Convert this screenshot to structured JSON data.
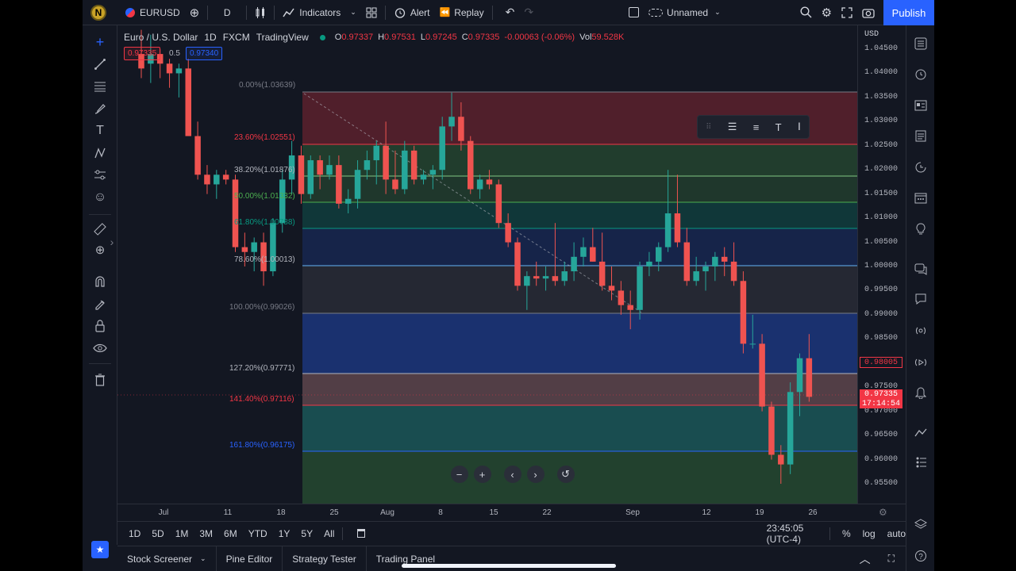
{
  "topbar": {
    "avatar_letter": "N",
    "symbol": "EURUSD",
    "add_symbol_icon": "plus-circle-icon",
    "interval": "D",
    "indicators_label": "Indicators",
    "alert_label": "Alert",
    "replay_label": "Replay",
    "layout_name": "Unnamed",
    "publish_label": "Publish"
  },
  "legend": {
    "title": "Euro / U.S. Dollar",
    "interval": "1D",
    "exchange": "FXCM",
    "source": "TradingView",
    "o_label": "O",
    "o_val": "0.97337",
    "h_label": "H",
    "h_val": "0.97531",
    "l_label": "L",
    "l_val": "0.97245",
    "c_label": "C",
    "c_val": "0.97335",
    "change": "-0.00063 (-0.06%)",
    "vol_label": "Vol",
    "vol_val": "59.528K"
  },
  "price_boxes": {
    "sell": "0.97335",
    "spread": "0.5",
    "buy": "0.97340"
  },
  "colors": {
    "up": "#26a69a",
    "down": "#ef5350",
    "background": "#131722",
    "accent": "#2962ff"
  },
  "fib_labels": [
    {
      "text": "0.00%(1.03639)",
      "color": "#787b86"
    },
    {
      "text": "23.60%(1.02551)",
      "color": "#f23645"
    },
    {
      "text": "38.20%(1.01876)",
      "color": "#b2b5be"
    },
    {
      "text": "50.00%(1.01332)",
      "color": "#4caf50"
    },
    {
      "text": "61.80%(1.00788)",
      "color": "#089981"
    },
    {
      "text": "78.60%(1.00013)",
      "color": "#b2b5be"
    },
    {
      "text": "100.00%(0.99026)",
      "color": "#787b86"
    },
    {
      "text": "127.20%(0.97771)",
      "color": "#b2b5be"
    },
    {
      "text": "141.40%(0.97116)",
      "color": "#f23645"
    },
    {
      "text": "161.80%(0.96175)",
      "color": "#2962ff"
    }
  ],
  "y_axis": {
    "currency": "USD",
    "ticks": [
      "1.04500",
      "1.04000",
      "1.03500",
      "1.03000",
      "1.02500",
      "1.02000",
      "1.01500",
      "1.01000",
      "1.00500",
      "1.00000",
      "0.99500",
      "0.99000",
      "0.98500",
      "0.98000",
      "0.97500",
      "0.97000",
      "0.96500",
      "0.96000",
      "0.95500"
    ],
    "tag_red": "0.98005",
    "tag_last": "0.97335",
    "tag_timer": "17:14:54"
  },
  "x_axis": {
    "ticks": [
      "Jul",
      "11",
      "18",
      "25",
      "Aug",
      "8",
      "15",
      "22",
      "Sep",
      "12",
      "19",
      "26"
    ]
  },
  "ranges": [
    "1D",
    "5D",
    "1M",
    "3M",
    "6M",
    "YTD",
    "1Y",
    "5Y",
    "All"
  ],
  "clock": "23:45:05 (UTC-4)",
  "scale_opts": {
    "percent": "%",
    "log": "log",
    "auto": "auto"
  },
  "bottom_tabs": [
    "Stock Screener",
    "Pine Editor",
    "Strategy Tester",
    "Trading Panel"
  ],
  "chart_data": {
    "type": "candlestick",
    "ylim": [
      0.95,
      1.05
    ],
    "candles": [
      {
        "o": 1.044,
        "h": 1.049,
        "l": 1.039,
        "c": 1.041
      },
      {
        "o": 1.042,
        "h": 1.048,
        "l": 1.038,
        "c": 1.044
      },
      {
        "o": 1.044,
        "h": 1.045,
        "l": 1.039,
        "c": 1.042
      },
      {
        "o": 1.042,
        "h": 1.043,
        "l": 1.037,
        "c": 1.04
      },
      {
        "o": 1.04,
        "h": 1.042,
        "l": 1.035,
        "c": 1.041
      },
      {
        "o": 1.041,
        "h": 1.043,
        "l": 1.028,
        "c": 1.027
      },
      {
        "o": 1.027,
        "h": 1.03,
        "l": 1.018,
        "c": 1.019
      },
      {
        "o": 1.019,
        "h": 1.021,
        "l": 1.015,
        "c": 1.017
      },
      {
        "o": 1.017,
        "h": 1.02,
        "l": 1.014,
        "c": 1.019
      },
      {
        "o": 1.019,
        "h": 1.02,
        "l": 1.017,
        "c": 1.018
      },
      {
        "o": 1.018,
        "h": 1.019,
        "l": 1.003,
        "c": 1.004
      },
      {
        "o": 1.004,
        "h": 1.007,
        "l": 1.0,
        "c": 1.003
      },
      {
        "o": 1.003,
        "h": 1.006,
        "l": 0.999,
        "c": 1.005
      },
      {
        "o": 1.005,
        "h": 1.007,
        "l": 0.996,
        "c": 0.999
      },
      {
        "o": 0.999,
        "h": 1.01,
        "l": 0.998,
        "c": 1.009
      },
      {
        "o": 1.009,
        "h": 1.02,
        "l": 1.007,
        "c": 1.018
      },
      {
        "o": 1.018,
        "h": 1.026,
        "l": 1.015,
        "c": 1.023
      },
      {
        "o": 1.023,
        "h": 1.025,
        "l": 1.013,
        "c": 1.015
      },
      {
        "o": 1.015,
        "h": 1.023,
        "l": 1.014,
        "c": 1.022
      },
      {
        "o": 1.022,
        "h": 1.023,
        "l": 1.016,
        "c": 1.019
      },
      {
        "o": 1.019,
        "h": 1.023,
        "l": 1.018,
        "c": 1.021
      },
      {
        "o": 1.021,
        "h": 1.023,
        "l": 1.012,
        "c": 1.013
      },
      {
        "o": 1.013,
        "h": 1.016,
        "l": 1.011,
        "c": 1.014
      },
      {
        "o": 1.014,
        "h": 1.022,
        "l": 1.012,
        "c": 1.02
      },
      {
        "o": 1.02,
        "h": 1.024,
        "l": 1.018,
        "c": 1.022
      },
      {
        "o": 1.022,
        "h": 1.026,
        "l": 1.017,
        "c": 1.025
      },
      {
        "o": 1.025,
        "h": 1.03,
        "l": 1.015,
        "c": 1.018
      },
      {
        "o": 1.018,
        "h": 1.024,
        "l": 1.015,
        "c": 1.016
      },
      {
        "o": 1.016,
        "h": 1.026,
        "l": 1.015,
        "c": 1.024
      },
      {
        "o": 1.024,
        "h": 1.025,
        "l": 1.017,
        "c": 1.018
      },
      {
        "o": 1.018,
        "h": 1.02,
        "l": 1.017,
        "c": 1.019
      },
      {
        "o": 1.019,
        "h": 1.021,
        "l": 1.016,
        "c": 1.02
      },
      {
        "o": 1.02,
        "h": 1.031,
        "l": 1.018,
        "c": 1.029
      },
      {
        "o": 1.029,
        "h": 1.036,
        "l": 1.026,
        "c": 1.031
      },
      {
        "o": 1.031,
        "h": 1.034,
        "l": 1.024,
        "c": 1.026
      },
      {
        "o": 1.026,
        "h": 1.027,
        "l": 1.015,
        "c": 1.016
      },
      {
        "o": 1.016,
        "h": 1.019,
        "l": 1.014,
        "c": 1.018
      },
      {
        "o": 1.018,
        "h": 1.02,
        "l": 1.016,
        "c": 1.017
      },
      {
        "o": 1.017,
        "h": 1.018,
        "l": 1.008,
        "c": 1.009
      },
      {
        "o": 1.009,
        "h": 1.011,
        "l": 1.004,
        "c": 1.005
      },
      {
        "o": 1.005,
        "h": 1.006,
        "l": 0.995,
        "c": 0.996
      },
      {
        "o": 0.996,
        "h": 0.999,
        "l": 0.991,
        "c": 0.998
      },
      {
        "o": 0.998,
        "h": 1.001,
        "l": 0.996,
        "c": 0.9975
      },
      {
        "o": 0.9975,
        "h": 1.0,
        "l": 0.995,
        "c": 0.998
      },
      {
        "o": 0.998,
        "h": 1.009,
        "l": 0.996,
        "c": 0.997
      },
      {
        "o": 0.997,
        "h": 1.001,
        "l": 0.996,
        "c": 0.999
      },
      {
        "o": 0.999,
        "h": 1.005,
        "l": 0.997,
        "c": 1.002
      },
      {
        "o": 1.002,
        "h": 1.006,
        "l": 1.0,
        "c": 1.004
      },
      {
        "o": 1.004,
        "h": 1.008,
        "l": 1.001,
        "c": 1.001
      },
      {
        "o": 1.001,
        "h": 1.007,
        "l": 0.995,
        "c": 0.996
      },
      {
        "o": 0.996,
        "h": 1.0,
        "l": 0.993,
        "c": 0.995
      },
      {
        "o": 0.995,
        "h": 0.997,
        "l": 0.99,
        "c": 0.992
      },
      {
        "o": 0.992,
        "h": 0.995,
        "l": 0.987,
        "c": 0.991
      },
      {
        "o": 0.991,
        "h": 1.001,
        "l": 0.989,
        "c": 1.0
      },
      {
        "o": 1.0,
        "h": 1.003,
        "l": 0.998,
        "c": 1.001
      },
      {
        "o": 1.001,
        "h": 1.005,
        "l": 0.999,
        "c": 1.004
      },
      {
        "o": 1.004,
        "h": 1.02,
        "l": 1.003,
        "c": 1.011
      },
      {
        "o": 1.011,
        "h": 1.019,
        "l": 1.004,
        "c": 1.005
      },
      {
        "o": 1.005,
        "h": 1.008,
        "l": 0.996,
        "c": 0.997
      },
      {
        "o": 0.997,
        "h": 1.002,
        "l": 0.996,
        "c": 0.999
      },
      {
        "o": 0.999,
        "h": 1.001,
        "l": 0.995,
        "c": 1.0
      },
      {
        "o": 1.0,
        "h": 1.003,
        "l": 0.997,
        "c": 1.002
      },
      {
        "o": 1.002,
        "h": 1.004,
        "l": 0.998,
        "c": 1.001
      },
      {
        "o": 1.001,
        "h": 1.005,
        "l": 0.996,
        "c": 0.997
      },
      {
        "o": 0.997,
        "h": 0.999,
        "l": 0.982,
        "c": 0.984
      },
      {
        "o": 0.984,
        "h": 0.99,
        "l": 0.983,
        "c": 0.984
      },
      {
        "o": 0.984,
        "h": 0.986,
        "l": 0.97,
        "c": 0.971
      },
      {
        "o": 0.971,
        "h": 0.972,
        "l": 0.96,
        "c": 0.961
      },
      {
        "o": 0.961,
        "h": 0.963,
        "l": 0.955,
        "c": 0.959
      },
      {
        "o": 0.959,
        "h": 0.976,
        "l": 0.957,
        "c": 0.974
      },
      {
        "o": 0.974,
        "h": 0.982,
        "l": 0.969,
        "c": 0.981
      },
      {
        "o": 0.981,
        "h": 0.986,
        "l": 0.972,
        "c": 0.973
      }
    ]
  }
}
